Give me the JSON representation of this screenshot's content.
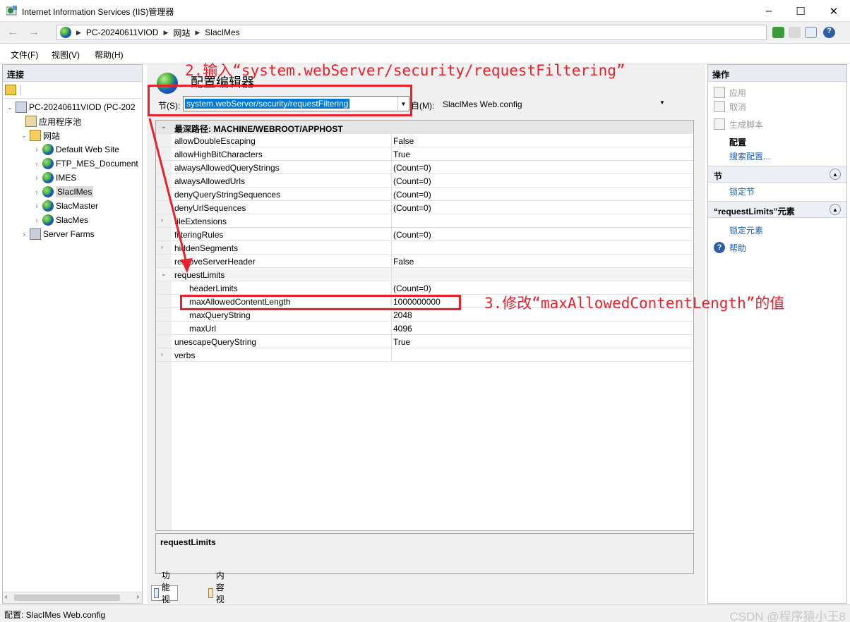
{
  "window": {
    "title": "Internet Information Services (IIS)管理器",
    "controls": [
      "–",
      "☐",
      "✕"
    ]
  },
  "address": {
    "path": [
      "PC-20240611VIOD",
      "网站",
      "SlacIMes"
    ]
  },
  "menu": [
    "文件(F)",
    "视图(V)",
    "帮助(H)"
  ],
  "connections": {
    "header": "连接",
    "tree": [
      {
        "label": "PC-20240611VIOD (PC-202",
        "expander": "⌄",
        "icon": "server-icon"
      },
      {
        "label": "应用程序池",
        "expander": "",
        "icon": "app-pool-icon"
      },
      {
        "label": "网站",
        "expander": "⌄",
        "icon": "sites-folder-icon"
      },
      {
        "label": "Default Web Site",
        "expander": "›",
        "icon": "website-icon"
      },
      {
        "label": "FTP_MES_Document",
        "expander": "›",
        "icon": "website-icon"
      },
      {
        "label": "IMES",
        "expander": "›",
        "icon": "website-icon"
      },
      {
        "label": "SlacIMes",
        "expander": "›",
        "icon": "website-icon",
        "selected": true
      },
      {
        "label": "SlacMaster",
        "expander": "›",
        "icon": "website-icon"
      },
      {
        "label": "SlacMes",
        "expander": "›",
        "icon": "website-icon"
      },
      {
        "label": "Server Farms",
        "expander": "›",
        "icon": "server-farms-icon"
      }
    ]
  },
  "editor": {
    "title": "配置编辑器",
    "section_label": "节(S):",
    "section_value": "system.webServer/security/requestFiltering",
    "from_label": "自(M):",
    "from_value": "SlacIMes Web.config",
    "header_row": "最深路径: MACHINE/WEBROOT/APPHOST",
    "rows": [
      {
        "name": "allowDoubleEscaping",
        "value": "False",
        "indent": 0,
        "expander": ""
      },
      {
        "name": "allowHighBitCharacters",
        "value": "True",
        "indent": 0,
        "expander": ""
      },
      {
        "name": "alwaysAllowedQueryStrings",
        "value": "(Count=0)",
        "indent": 0,
        "expander": ""
      },
      {
        "name": "alwaysAllowedUrls",
        "value": "(Count=0)",
        "indent": 0,
        "expander": ""
      },
      {
        "name": "denyQueryStringSequences",
        "value": "(Count=0)",
        "indent": 0,
        "expander": ""
      },
      {
        "name": "denyUrlSequences",
        "value": "(Count=0)",
        "indent": 0,
        "expander": ""
      },
      {
        "name": "fileExtensions",
        "value": "",
        "indent": 0,
        "expander": "›"
      },
      {
        "name": "filteringRules",
        "value": "(Count=0)",
        "indent": 0,
        "expander": ""
      },
      {
        "name": "hiddenSegments",
        "value": "",
        "indent": 0,
        "expander": "›"
      },
      {
        "name": "removeServerHeader",
        "value": "False",
        "indent": 0,
        "expander": ""
      },
      {
        "name": "requestLimits",
        "value": "",
        "indent": 0,
        "expander": "⌄",
        "group": true
      },
      {
        "name": "headerLimits",
        "value": "(Count=0)",
        "indent": 1,
        "expander": ""
      },
      {
        "name": "maxAllowedContentLength",
        "value": "1000000000",
        "indent": 1,
        "expander": ""
      },
      {
        "name": "maxQueryString",
        "value": "2048",
        "indent": 1,
        "expander": ""
      },
      {
        "name": "maxUrl",
        "value": "4096",
        "indent": 1,
        "expander": ""
      },
      {
        "name": "unescapeQueryString",
        "value": "True",
        "indent": 0,
        "expander": ""
      },
      {
        "name": "verbs",
        "value": "",
        "indent": 0,
        "expander": "›"
      }
    ],
    "description_title": "requestLimits",
    "view_tabs": [
      "功能视图",
      "内容视图"
    ]
  },
  "actions": {
    "header": "操作",
    "apply": "应用",
    "cancel": "取消",
    "generate_script": "生成脚本",
    "config_heading": "配置",
    "search_config": "搜索配置...",
    "section_group": "节",
    "lock_section": "锁定节",
    "element_group": "“requestLimits”元素",
    "lock_element": "锁定元素",
    "help": "帮助"
  },
  "status": {
    "text": "配置: SlacIMes Web.config",
    "watermark": "CSDN @程序猿小王8"
  },
  "annotations": {
    "step2": "2.输入“system.webServer/security/requestFiltering”",
    "step3": "3.修改“maxAllowedContentLength”的值",
    "color": "#e8212a"
  }
}
